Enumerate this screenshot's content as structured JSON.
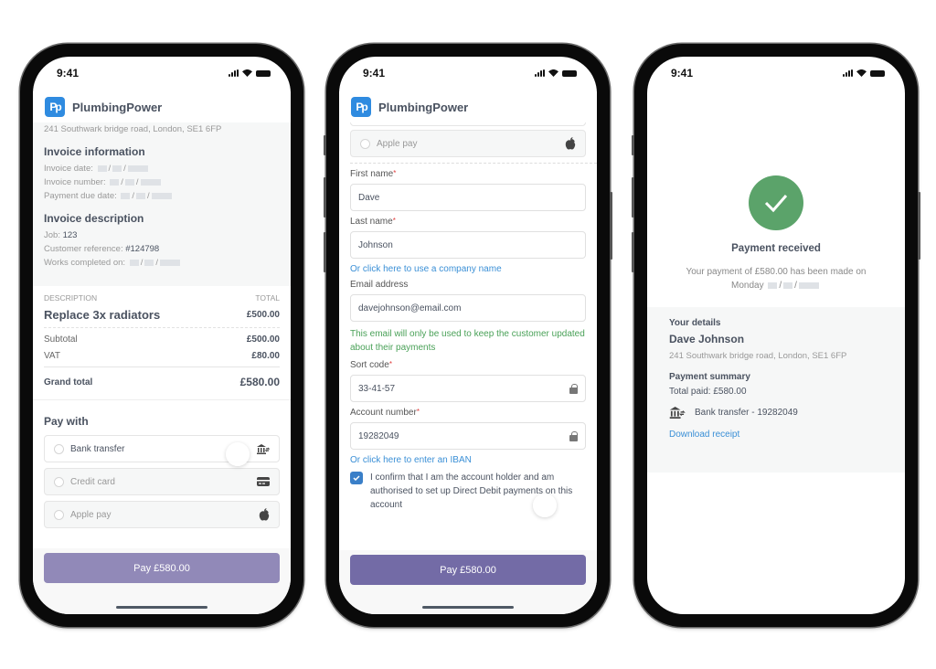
{
  "status_time": "9:41",
  "brand": {
    "name": "PlumbingPower",
    "logo_text": "Pp",
    "color": "#2f8be0"
  },
  "invoice_screen": {
    "address": "241 Southwark bridge road, London, SE1 6FP",
    "invoice_info": {
      "heading": "Invoice information",
      "invoice_date_label": "Invoice date:",
      "invoice_number_label": "Invoice number:",
      "payment_due_label": "Payment due date:"
    },
    "invoice_desc": {
      "heading": "Invoice description",
      "job_label": "Job:",
      "job_value": "123",
      "customer_ref_label": "Customer reference:",
      "customer_ref_value": "#124798",
      "works_completed_label": "Works completed on:"
    },
    "table": {
      "col_description": "DESCRIPTION",
      "col_total": "TOTAL",
      "item": "Replace 3x radiators",
      "item_total": "£500.00",
      "subtotal_label": "Subtotal",
      "subtotal_value": "£500.00",
      "vat_label": "VAT",
      "vat_value": "£80.00",
      "grand_total_label": "Grand total",
      "grand_total_value": "£580.00"
    },
    "pay_with": {
      "heading": "Pay with",
      "options": [
        {
          "label": "Bank transfer",
          "icon": "bank-transfer-icon"
        },
        {
          "label": "Credit card",
          "icon": "credit-card-icon"
        },
        {
          "label": "Apple pay",
          "icon": "apple-icon"
        }
      ]
    },
    "pay_button": "Pay £580.00",
    "pay_button_color": "#9189b8"
  },
  "bank_form_screen": {
    "apple_pay_label": "Apple pay",
    "first_name_label": "First name",
    "first_name_value": "Dave",
    "last_name_label": "Last name",
    "last_name_value": "Johnson",
    "company_link": "Or click here to use a company name",
    "email_label": "Email address",
    "email_value": "davejohnson@email.com",
    "email_hint": "This email will only be used to keep the customer updated about their payments",
    "sort_code_label": "Sort code",
    "sort_code_value": "33-41-57",
    "account_number_label": "Account number",
    "account_number_value": "19282049",
    "iban_link": "Or click here to enter an IBAN",
    "confirm_text": "I confirm that I am the account holder and am authorised to set up Direct Debit payments on this account",
    "confirm_checked": true,
    "required_mark": "*",
    "pay_button": "Pay £580.00",
    "pay_button_color": "#736ba6"
  },
  "success_screen": {
    "title": "Payment received",
    "message": "Your payment of £580.00 has been made on",
    "day": "Monday",
    "your_details_heading": "Your details",
    "name": "Dave Johnson",
    "address": "241 Southwark bridge road, London, SE1 6FP",
    "summary_heading": "Payment summary",
    "total_paid": "Total paid: £580.00",
    "method": "Bank transfer - 19282049",
    "download_link": "Download receipt",
    "success_color": "#5ba36a"
  }
}
